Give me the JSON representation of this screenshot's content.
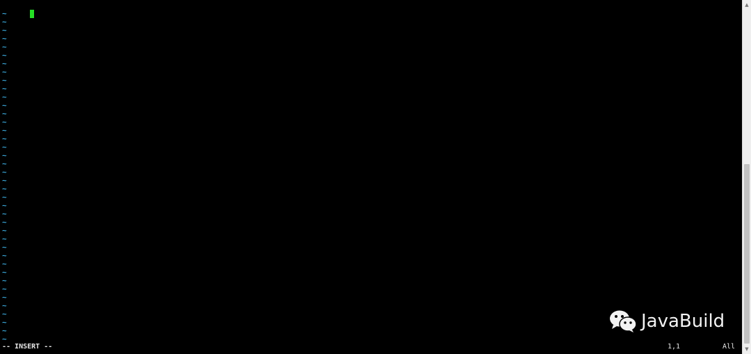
{
  "editor": {
    "empty_line_marker": "~",
    "empty_line_count": 40,
    "cursor_color": "#25e025",
    "marker_color": "#3aa6d8"
  },
  "statusline": {
    "mode": "-- INSERT --",
    "position": "1,1",
    "scroll": "All"
  },
  "watermark": {
    "logo": "wechat-icon",
    "text": "JavaBuild"
  },
  "scrollbar": {
    "up_icon": "scroll-up-arrow-icon",
    "down_icon": "scroll-down-arrow-icon"
  }
}
